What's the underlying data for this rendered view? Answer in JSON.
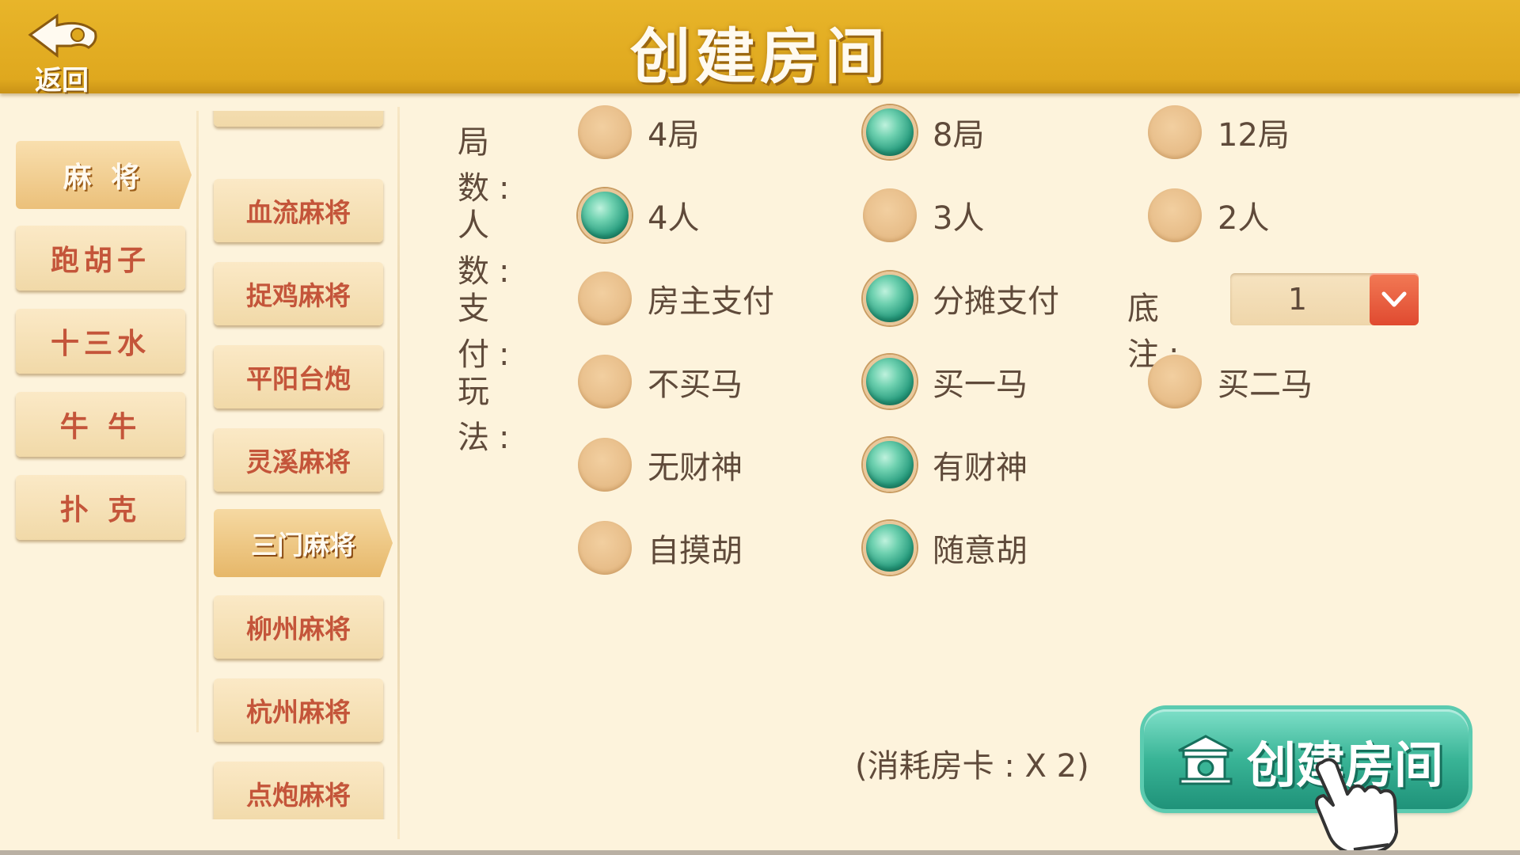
{
  "header": {
    "title": "创建房间",
    "back_label": "返回"
  },
  "categories": [
    {
      "label": "麻 将",
      "active": true
    },
    {
      "label": "跑胡子",
      "active": false
    },
    {
      "label": "十三水",
      "active": false
    },
    {
      "label": "牛 牛",
      "active": false
    },
    {
      "label": "扑 克",
      "active": false
    }
  ],
  "sub_games": [
    {
      "label": "",
      "active": false
    },
    {
      "label": "血流麻将",
      "active": false
    },
    {
      "label": "捉鸡麻将",
      "active": false
    },
    {
      "label": "平阳台炮",
      "active": false
    },
    {
      "label": "灵溪麻将",
      "active": false
    },
    {
      "label": "三门麻将",
      "active": true
    },
    {
      "label": "柳州麻将",
      "active": false
    },
    {
      "label": "杭州麻将",
      "active": false
    },
    {
      "label": "点炮麻将",
      "active": false
    }
  ],
  "options": {
    "rounds": {
      "label": "局 数:",
      "choices": [
        {
          "text": "4局",
          "selected": false
        },
        {
          "text": "8局",
          "selected": true
        },
        {
          "text": "12局",
          "selected": false
        }
      ]
    },
    "players": {
      "label": "人 数:",
      "choices": [
        {
          "text": "4人",
          "selected": true
        },
        {
          "text": "3人",
          "selected": false
        },
        {
          "text": "2人",
          "selected": false
        }
      ]
    },
    "payment": {
      "label": "支 付:",
      "choices": [
        {
          "text": "房主支付",
          "selected": false
        },
        {
          "text": "分摊支付",
          "selected": true
        }
      ]
    },
    "base_bet": {
      "label": "底 注:",
      "value": "1"
    },
    "gameplay": {
      "label": "玩 法:",
      "row1": [
        {
          "text": "不买马",
          "selected": false
        },
        {
          "text": "买一马",
          "selected": true
        },
        {
          "text": "买二马",
          "selected": false
        }
      ],
      "row2": [
        {
          "text": "无财神",
          "selected": false
        },
        {
          "text": "有财神",
          "selected": true
        }
      ],
      "row3": [
        {
          "text": "自摸胡",
          "selected": false
        },
        {
          "text": "随意胡",
          "selected": true
        }
      ]
    }
  },
  "footer": {
    "cost_text": "(消耗房卡 : X 2)",
    "create_label": "创建房间"
  },
  "icons": {
    "back": "back-arrow-icon",
    "dropdown": "chevron-down-icon",
    "create": "house-icon",
    "pointer": "hand-pointer-icon"
  },
  "colors": {
    "header": "#dfa81e",
    "background": "#fdf3dc",
    "radio_selected": "#2a9e80",
    "radio_unselected": "#e6bb86",
    "button_text": "#c4553a",
    "create_button": "#39b496",
    "dropdown_button": "#e04a30"
  }
}
